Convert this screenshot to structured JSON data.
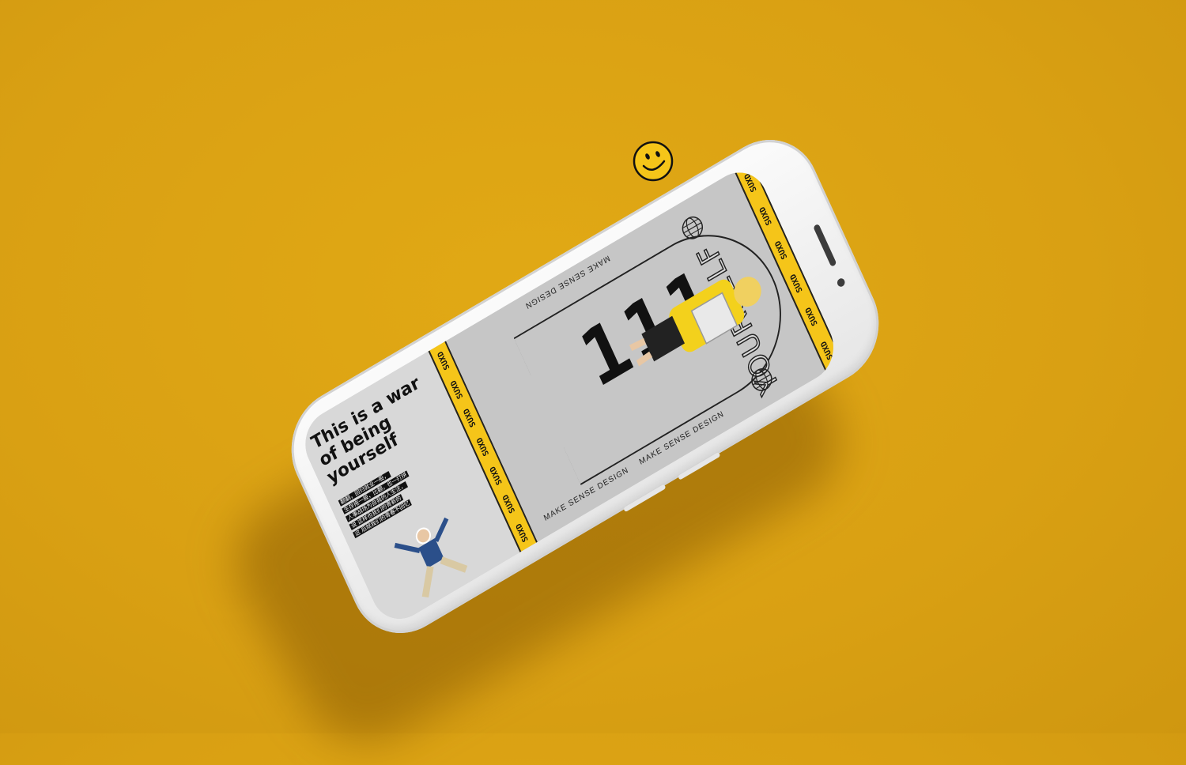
{
  "headline": "This is a war of being yourself",
  "blurb_lines": [
    "翻翻，回归就业一般，",
    "生存拖一般，比翻，也一打拼",
    "人事战场为自我的人生注，",
    "说 这样也我们的青新的",
    "这 后就我们的青春不回忆"
  ],
  "big_number": "111",
  "arch_word": "YOURSELF",
  "tagline": "MAKE SENSE DESIGN",
  "tagline_repeat": "MAKE SENSE DESIGN",
  "stripe_word": "SUXD",
  "colors": {
    "background": "#d9a013",
    "accent_yellow": "#f5c519",
    "screen_gray": "#c6c6c6",
    "ink": "#111111"
  },
  "icons": [
    "smiley-icon",
    "globe-icon",
    "globe-icon"
  ]
}
